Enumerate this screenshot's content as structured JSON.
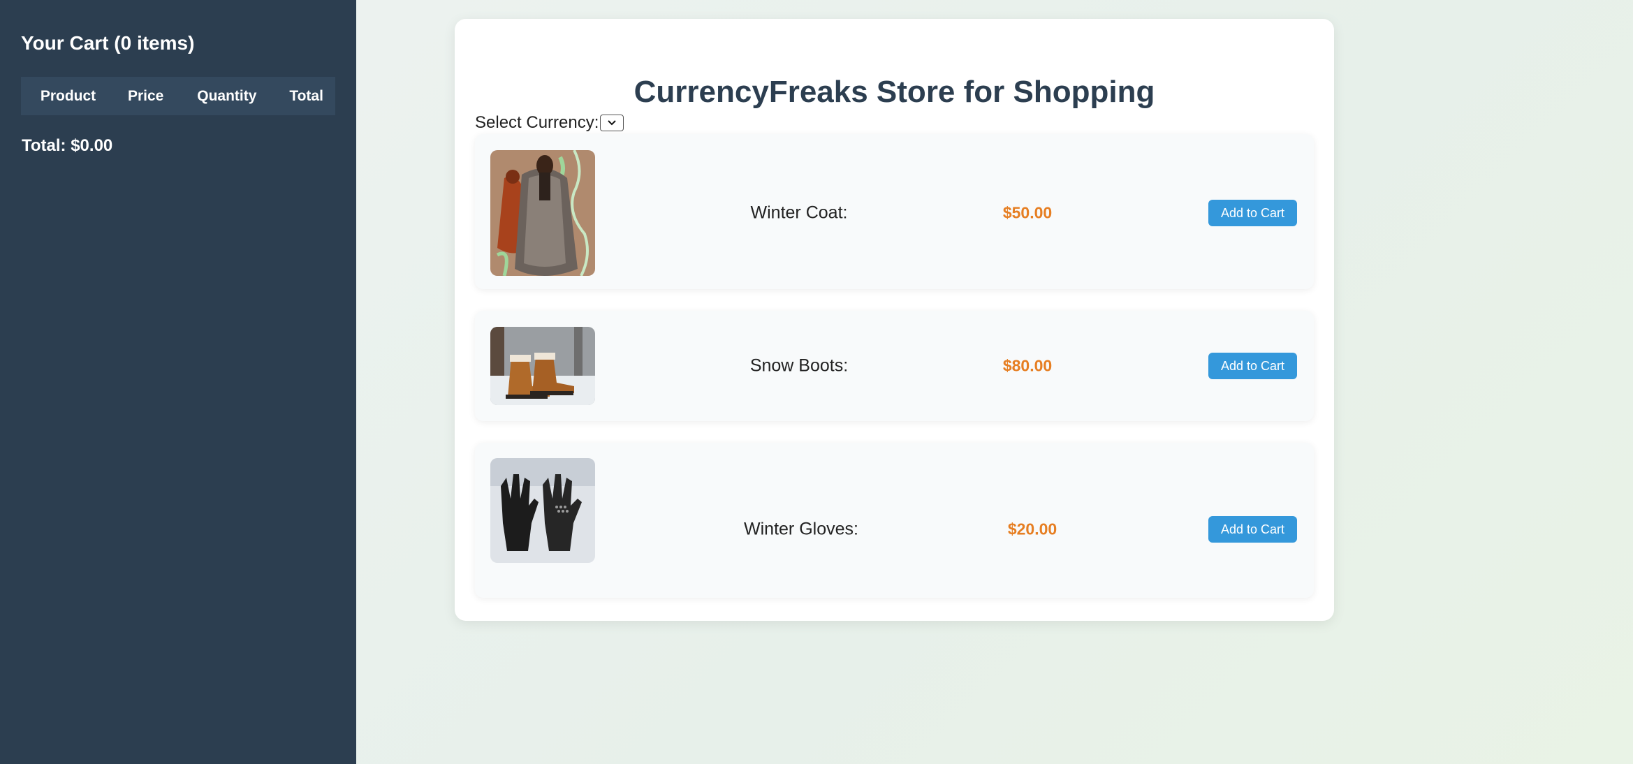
{
  "cart": {
    "title": "Your Cart (0 items)",
    "columns": [
      "Product",
      "Price",
      "Quantity",
      "Total"
    ],
    "total": "Total: $0.00"
  },
  "store": {
    "title": "CurrencyFreaks Store for Shopping",
    "currency_label": "Select Currency:",
    "currency_selected": "",
    "products": [
      {
        "name": "Winter Coat:",
        "price": "$50.00",
        "button": "Add to Cart",
        "image": "winter-coat-photo"
      },
      {
        "name": "Snow Boots:",
        "price": "$80.00",
        "button": "Add to Cart",
        "image": "snow-boots-photo"
      },
      {
        "name": "Winter Gloves:",
        "price": "$20.00",
        "button": "Add to Cart",
        "image": "winter-gloves-photo"
      }
    ]
  },
  "colors": {
    "sidebar": "#2c3e50",
    "table_header": "#34495e",
    "title": "#2c3e50",
    "price": "#e67e22",
    "button": "#3498db"
  }
}
